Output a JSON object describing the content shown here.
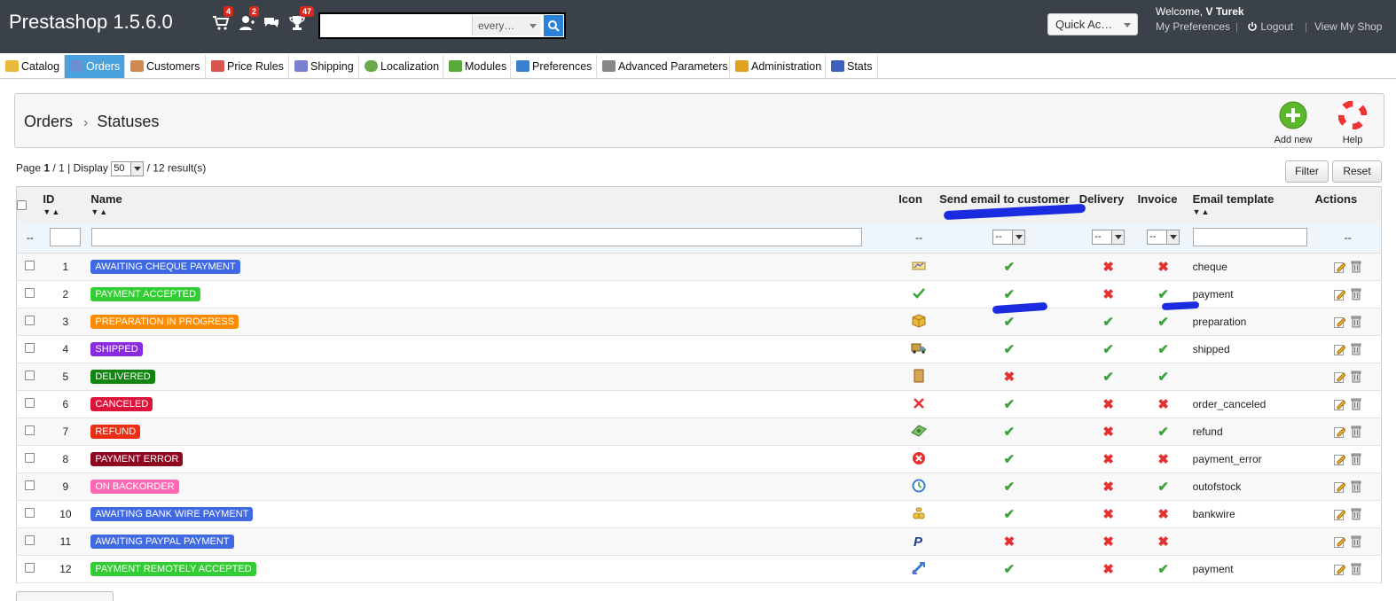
{
  "header": {
    "shop_title": "Prestashop 1.5.6.0",
    "notifications": {
      "orders_count": "4",
      "customers_count": "2",
      "messages_count": "",
      "achievements_count": "47"
    },
    "search": {
      "value": "",
      "scope": "every…"
    },
    "quick_access": "Quick Ac…",
    "welcome_prefix": "Welcome,",
    "welcome_user": "V Turek",
    "my_preferences": "My Preferences",
    "logout": "Logout",
    "view_shop": "View My Shop",
    "link_separator": "|"
  },
  "tabs": [
    {
      "label": "Catalog",
      "color": "#e8b83a"
    },
    {
      "label": "Orders",
      "color": "#6b8fcf"
    },
    {
      "label": "Customers",
      "color": "#d08a50"
    },
    {
      "label": "Price Rules",
      "color": "#d9534f"
    },
    {
      "label": "Shipping",
      "color": "#7a7fd0"
    },
    {
      "label": "Localization",
      "color": "#6aa94b"
    },
    {
      "label": "Modules",
      "color": "#59a83a"
    },
    {
      "label": "Preferences",
      "color": "#3a7fd0"
    },
    {
      "label": "Advanced Parameters",
      "color": "#888888"
    },
    {
      "label": "Administration",
      "color": "#e0a020"
    },
    {
      "label": "Stats",
      "color": "#4060c0"
    }
  ],
  "breadcrumb": {
    "parent": "Orders",
    "current": "Statuses",
    "separator": "›"
  },
  "toolbar": {
    "add_new": "Add new",
    "help": "Help"
  },
  "list": {
    "page_label": "Page",
    "page_current": "1",
    "page_separator": "/",
    "page_total": "1",
    "display_label": "| Display",
    "per_page": "50",
    "results": "/ 12 result(s)",
    "filter_button": "Filter",
    "reset_button": "Reset"
  },
  "table": {
    "columns": {
      "id": "ID",
      "name": "Name",
      "icon": "Icon",
      "send_email": "Send email to customer",
      "delivery": "Delivery",
      "invoice": "Invoice",
      "email_template": "Email template",
      "actions": "Actions"
    },
    "sort_arrows": "▼▲",
    "filter_row": {
      "placeholder_dash": "--",
      "select_value": "--"
    },
    "rows": [
      {
        "id": "1",
        "name": "AWAITING CHEQUE PAYMENT",
        "color": "#4169e1",
        "send_email": "✔",
        "delivery": "✖",
        "invoice": "✖",
        "template": "cheque",
        "icon": "cheque-icon"
      },
      {
        "id": "2",
        "name": "PAYMENT ACCEPTED",
        "color": "#32cd32",
        "send_email": "✔",
        "delivery": "✖",
        "invoice": "✔",
        "template": "payment",
        "icon": "check-icon"
      },
      {
        "id": "3",
        "name": "PREPARATION IN PROGRESS",
        "color": "#ff8c00",
        "send_email": "✔",
        "delivery": "✔",
        "invoice": "✔",
        "template": "preparation",
        "icon": "box-icon"
      },
      {
        "id": "4",
        "name": "SHIPPED",
        "color": "#8a2be2",
        "send_email": "✔",
        "delivery": "✔",
        "invoice": "✔",
        "template": "shipped",
        "icon": "truck-icon"
      },
      {
        "id": "5",
        "name": "DELIVERED",
        "color": "#108510",
        "send_email": "✖",
        "delivery": "✔",
        "invoice": "✔",
        "template": "",
        "icon": "door-icon"
      },
      {
        "id": "6",
        "name": "CANCELED",
        "color": "#dc143c",
        "send_email": "✔",
        "delivery": "✖",
        "invoice": "✖",
        "template": "order_canceled",
        "icon": "cross-icon"
      },
      {
        "id": "7",
        "name": "REFUND",
        "color": "#ec2e15",
        "send_email": "✔",
        "delivery": "✖",
        "invoice": "✔",
        "template": "refund",
        "icon": "money-icon"
      },
      {
        "id": "8",
        "name": "PAYMENT ERROR",
        "color": "#8f0621",
        "send_email": "✔",
        "delivery": "✖",
        "invoice": "✖",
        "template": "payment_error",
        "icon": "error-icon"
      },
      {
        "id": "9",
        "name": "ON BACKORDER",
        "color": "#ff69b4",
        "send_email": "✔",
        "delivery": "✖",
        "invoice": "✔",
        "template": "outofstock",
        "icon": "clock-icon"
      },
      {
        "id": "10",
        "name": "AWAITING BANK WIRE PAYMENT",
        "color": "#4169e1",
        "send_email": "✔",
        "delivery": "✖",
        "invoice": "✖",
        "template": "bankwire",
        "icon": "coins-icon"
      },
      {
        "id": "11",
        "name": "AWAITING PAYPAL PAYMENT",
        "color": "#4169e1",
        "send_email": "✖",
        "delivery": "✖",
        "invoice": "✖",
        "template": "",
        "icon": "paypal-icon"
      },
      {
        "id": "12",
        "name": "PAYMENT REMOTELY ACCEPTED",
        "color": "#32cd32",
        "send_email": "✔",
        "delivery": "✖",
        "invoice": "✔",
        "template": "payment",
        "icon": "transfer-icon"
      }
    ]
  }
}
